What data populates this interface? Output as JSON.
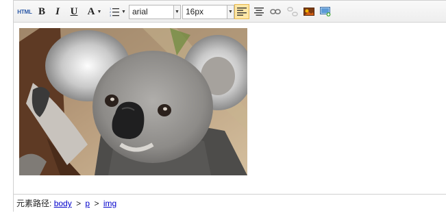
{
  "toolbar": {
    "source_label": "HTML",
    "bold_label": "B",
    "italic_label": "I",
    "underline_label": "U",
    "font_color_label": "A",
    "font_family_value": "arial",
    "font_size_value": "16px",
    "active_button": "align-left",
    "colors": {
      "active_bg": "#fde7a6",
      "active_border": "#e8b84c"
    }
  },
  "content": {
    "image_subject": "koala"
  },
  "status": {
    "path_label": "元素路径:",
    "path": [
      "body",
      "p",
      "img"
    ],
    "separator": ">"
  }
}
